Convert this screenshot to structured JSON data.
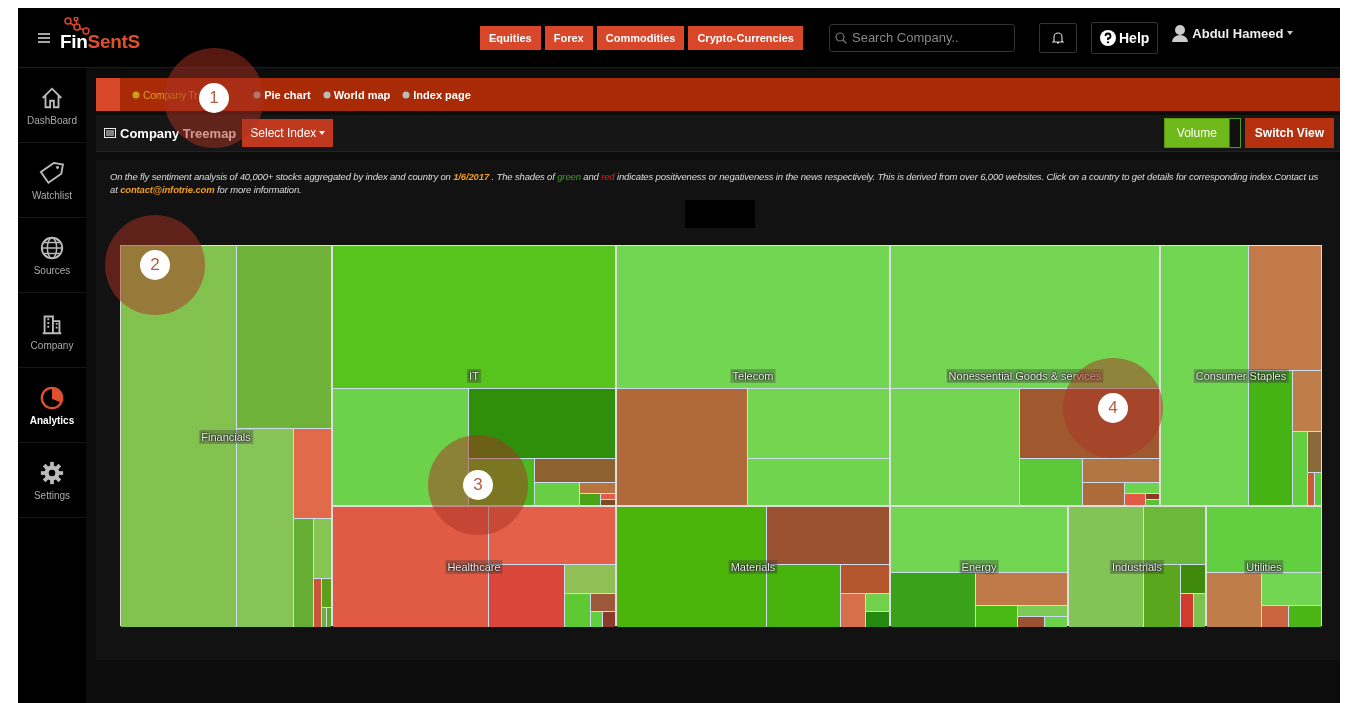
{
  "brand": {
    "part_1": "Fin",
    "part_2": "SentS"
  },
  "nav": [
    {
      "label": "Equities"
    },
    {
      "label": "Forex"
    },
    {
      "label": "Commodities"
    },
    {
      "label": "Crypto-Currencies"
    }
  ],
  "search": {
    "placeholder": "Search Company.."
  },
  "help": {
    "label": "Help"
  },
  "user": {
    "name": "Abdul Hameed"
  },
  "sidebar": {
    "items": [
      {
        "label": "DashBoard",
        "selected": false
      },
      {
        "label": "Watchlist",
        "selected": false
      },
      {
        "label": "Sources",
        "selected": false
      },
      {
        "label": "Company",
        "selected": false
      },
      {
        "label": "Analytics",
        "selected": true
      },
      {
        "label": "Settings",
        "selected": false
      }
    ]
  },
  "tabs": [
    {
      "label": "Company Tr",
      "selected": true
    },
    {
      "label": "Pie chart",
      "selected": false
    },
    {
      "label": "World map",
      "selected": false
    },
    {
      "label": "Index page",
      "selected": false
    }
  ],
  "header": {
    "title": "Company Treemap",
    "select": "Select Index",
    "toggle": {
      "label": "Volume",
      "on": true
    },
    "switch": "Switch View"
  },
  "description": [
    {
      "kind": "plain",
      "text": "On the fly sentiment analysis of 40,000+ stocks aggregated by index and country on "
    },
    {
      "kind": "date",
      "text": "1/6/2017"
    },
    {
      "kind": "plain",
      "text": " . The shades of "
    },
    {
      "kind": "green",
      "text": "green"
    },
    {
      "kind": "plain",
      "text": " and "
    },
    {
      "kind": "red",
      "text": "red"
    },
    {
      "kind": "plain",
      "text": " indicates positiveness or negativeness in the news respectively. This is derived from over 6,000 websites. Click on a country to get details for corresponding index.Contact us at "
    },
    {
      "kind": "link",
      "text": "contact@infotrie.com"
    },
    {
      "kind": "plain",
      "text": " for more information."
    }
  ],
  "treemap": {
    "sectors": [
      {
        "label": "Financials",
        "tiles": [
          {
            "color": "#84c24f"
          },
          {
            "color": "#6fb33a"
          },
          {
            "color": "#86c458"
          },
          {
            "color": "#e06a4a"
          },
          {
            "color": "#66ad33"
          },
          {
            "color": "#86c454"
          },
          {
            "color": "#c9553a"
          },
          {
            "color": "#5a9e1a"
          },
          {
            "color": "#6bb03a"
          },
          {
            "color": "#5fa62a"
          }
        ]
      },
      {
        "label": "IT",
        "tiles": [
          {
            "color": "#56c41c"
          },
          {
            "color": "#6cd24a"
          },
          {
            "color": "#2f8f0a"
          },
          {
            "color": "#4cba1e"
          },
          {
            "color": "#8d6230"
          },
          {
            "color": "#68cf45"
          },
          {
            "color": "#b8743e"
          },
          {
            "color": "#4aa316"
          },
          {
            "color": "#e05d48"
          },
          {
            "color": "#7a4a22"
          }
        ]
      },
      {
        "label": "Healthcare",
        "tiles": [
          {
            "color": "#e05a44"
          },
          {
            "color": "#e46048"
          },
          {
            "color": "#d9463a"
          },
          {
            "color": "#8fbf55"
          },
          {
            "color": "#5fc933"
          },
          {
            "color": "#9c5838"
          },
          {
            "color": "#62cf40"
          },
          {
            "color": "#8b3a2c"
          }
        ]
      },
      {
        "label": "Telecom",
        "tiles": [
          {
            "color": "#72d652"
          },
          {
            "color": "#b06a3a"
          },
          {
            "color": "#74d650"
          },
          {
            "color": "#70d44e"
          }
        ]
      },
      {
        "label": "Materials",
        "tiles": [
          {
            "color": "#4ab40a"
          },
          {
            "color": "#9b5230"
          },
          {
            "color": "#48b30c"
          },
          {
            "color": "#b5562e"
          },
          {
            "color": "#d86f4c"
          },
          {
            "color": "#6fd24a"
          },
          {
            "color": "#238a0f"
          }
        ]
      },
      {
        "label": "Nonessential Goods & services",
        "tiles": [
          {
            "color": "#74d653"
          },
          {
            "color": "#72d450"
          },
          {
            "color": "#a0582f"
          },
          {
            "color": "#5cc83a"
          },
          {
            "color": "#b27645"
          },
          {
            "color": "#ad6a3a"
          },
          {
            "color": "#6ed44f"
          },
          {
            "color": "#e05a44"
          },
          {
            "color": "#8a3a26"
          },
          {
            "color": "#58c236"
          }
        ]
      },
      {
        "label": "Consumer Staples",
        "tiles": [
          {
            "color": "#72d652"
          },
          {
            "color": "#c27a48"
          },
          {
            "color": "#46b314"
          },
          {
            "color": "#bf7d4a"
          },
          {
            "color": "#62cf40"
          },
          {
            "color": "#8a6a3a"
          },
          {
            "color": "#cf5a3a"
          },
          {
            "color": "#5ec63a"
          }
        ]
      },
      {
        "label": "Energy",
        "tiles": [
          {
            "color": "#72d652"
          },
          {
            "color": "#3aa11a"
          },
          {
            "color": "#c07a4a"
          },
          {
            "color": "#4ab812"
          },
          {
            "color": "#7ccb55"
          },
          {
            "color": "#9b5230"
          },
          {
            "color": "#6cd24a"
          }
        ]
      },
      {
        "label": "Industrials",
        "tiles": [
          {
            "color": "#82c455"
          },
          {
            "color": "#6bb83a"
          },
          {
            "color": "#5aa61c"
          },
          {
            "color": "#3f8a0a"
          },
          {
            "color": "#d33a2e"
          },
          {
            "color": "#7cc24f"
          }
        ]
      },
      {
        "label": "Utilities",
        "tiles": [
          {
            "color": "#62cf40"
          },
          {
            "color": "#bf7d4a"
          },
          {
            "color": "#72d652"
          },
          {
            "color": "#c8643e"
          },
          {
            "color": "#4ab514"
          }
        ]
      }
    ]
  },
  "markers": [
    {
      "label": "1"
    },
    {
      "label": "2"
    },
    {
      "label": "3"
    },
    {
      "label": "4"
    }
  ]
}
